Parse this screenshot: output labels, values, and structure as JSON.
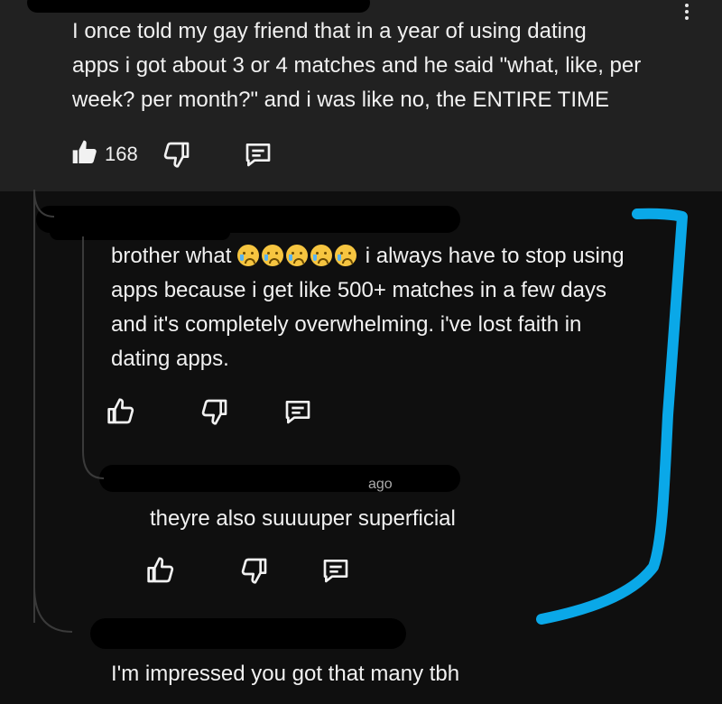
{
  "comment1": {
    "lines": [
      "I once told my gay friend that in a year of using dating",
      "apps i got about 3 or 4 matches and he said \"what, like, per",
      "week? per month?\" and i was like no, the ENTIRE TIME"
    ],
    "like_count": "168"
  },
  "reply1": {
    "prefix": "brother what",
    "suffix": "i always have to stop using",
    "lines": [
      "apps because i get like 500+ matches in a few days",
      "and it's completely overwhelming. i've lost faith in",
      "dating apps."
    ]
  },
  "reply2": {
    "meta_time": "ago",
    "text": "theyre also suuuuper superficial"
  },
  "reply3": {
    "text": "I'm impressed you got that many tbh"
  },
  "icons": [
    "thumbs-up-icon",
    "thumbs-down-icon",
    "reply-icon",
    "more-vert-icon"
  ],
  "colors": {
    "background": "#0f0f0f",
    "top_comment_bg": "#212121",
    "annotation": "#0aa8e8",
    "text": "#f1f1f1"
  }
}
